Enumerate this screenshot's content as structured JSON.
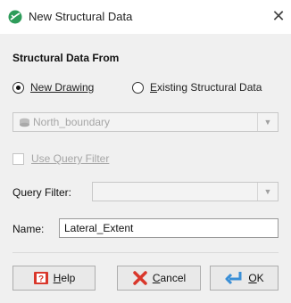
{
  "window": {
    "title": "New Structural Data",
    "close_glyph": "✕"
  },
  "section": {
    "title": "Structural Data From"
  },
  "radios": [
    {
      "label": "New Drawing",
      "checked": true
    },
    {
      "label": "Existing Structural Data",
      "checked": false
    }
  ],
  "source_combo": {
    "value": "North_boundary",
    "icon": "cylinder-icon",
    "enabled": false
  },
  "use_query_filter": {
    "label": "Use Query Filter",
    "checked": false,
    "enabled": false
  },
  "query_filter": {
    "label": "Query Filter:",
    "value": ""
  },
  "name": {
    "label": "Name:",
    "value": "Lateral_Extent"
  },
  "buttons": {
    "help": "Help",
    "cancel": "Cancel",
    "ok": "OK"
  },
  "colors": {
    "panel_bg": "#f0f0f0",
    "title_icon": "#2e9c5a",
    "disabled_text": "#a6a6a6"
  }
}
